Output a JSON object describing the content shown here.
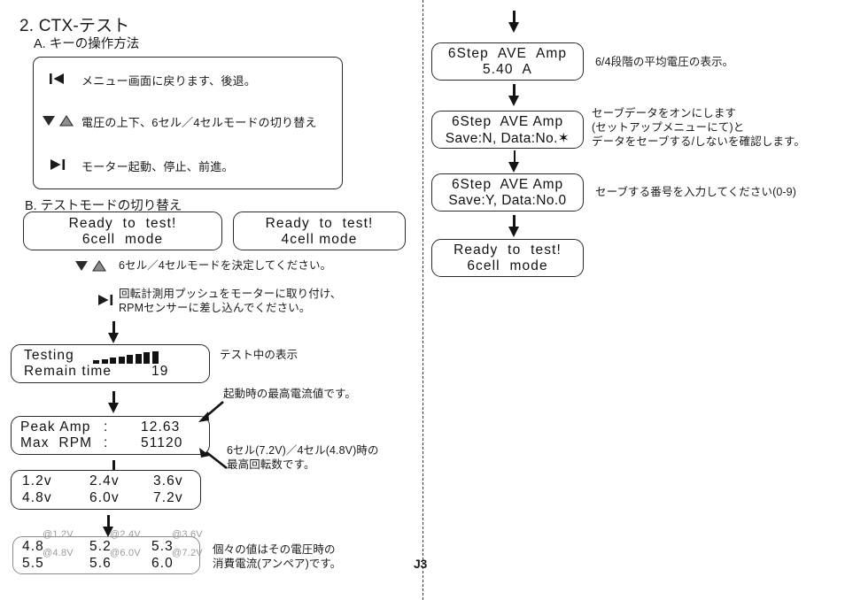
{
  "document": {
    "title": "2. CTX-テスト",
    "page_mark": "J3"
  },
  "section_a": {
    "heading": "A. キーの操作方法",
    "keys": [
      {
        "icon": "skip-back-icon",
        "glyph": "|◀",
        "description": "メニュー画面に戻ります、後退。"
      },
      {
        "icon": "up-down-arrows-icon",
        "glyph": "▼ ▲",
        "description": "電圧の上下、6セル／4セルモードの切り替え"
      },
      {
        "icon": "play-to-end-icon",
        "glyph": "▶|",
        "description": "モーター起動、停止、前進。"
      }
    ]
  },
  "section_b": {
    "heading": "B. テストモードの切り替え",
    "mode_boxes": [
      {
        "line1": "Ready  to  test!",
        "line2": "6cell  mode"
      },
      {
        "line1": "Ready  to  test!",
        "line2": "4cell mode"
      }
    ],
    "step_updown": {
      "glyph": "▼ ▲",
      "text": "6セル／4セルモードを決定してください。"
    },
    "step_play": {
      "glyph": "▶|",
      "text": "回転計測用プッシュをモーターに取り付け、\nRPMセンサーに差し込んでください。"
    },
    "testing_box": {
      "label": "Testing",
      "line2_label": "Remain time",
      "line2_value": "19",
      "progress_blocks": [
        4,
        5,
        7,
        8,
        10,
        11,
        13,
        14
      ]
    },
    "testing_note": "テスト中の表示",
    "peak_box": {
      "row1_label": "Peak Amp",
      "row1_sep": ":",
      "row1_value": "12.63",
      "row2_label": "Max  RPM",
      "row2_sep": ":",
      "row2_value": "51120"
    },
    "peak_note": "起動時の最高電流値です。",
    "rpm_note": "6セル(7.2V)／4セル(4.8V)時の\n最高回転数です。",
    "voltage_box": {
      "row1": [
        "1.2v",
        "2.4v",
        "3.6v"
      ],
      "row2": [
        "4.8v",
        "6.0v",
        "7.2v"
      ]
    },
    "amp_box": {
      "row1_values": [
        "4.8",
        "5.2",
        "5.3"
      ],
      "row1_at": [
        "@1.2V",
        "@2.4V",
        "@3.6V"
      ],
      "row2_values": [
        "5.5",
        "5.6",
        "6.0"
      ],
      "row2_at": [
        "@4.8V",
        "@6.0V",
        "@7.2V"
      ]
    },
    "amp_note": "個々の値はその電圧時の\n消費電流(アンペア)です。"
  },
  "right_column": {
    "ave_amp_box": {
      "line1": "6Step  AVE  Amp",
      "line2": "5.40  A"
    },
    "ave_amp_note": "6/4段階の平均電圧の表示。",
    "save_n_box": {
      "line1": "6Step  AVE Amp",
      "line2": "Save:N, Data:No.✶"
    },
    "save_n_note": "セーブデータをオンにします\n(セットアップメニューにて)と\nデータをセーブする/しないを確認します。",
    "save_y_box": {
      "line1": "6Step  AVE Amp",
      "line2": "Save:Y, Data:No.0"
    },
    "save_y_note": "セーブする番号を入力してください(0-9)",
    "ready_box": {
      "line1": "Ready  to  test!",
      "line2": "6cell  mode"
    }
  },
  "colors": {
    "ink": "#1a1a1a",
    "muted": "#9a9a9a",
    "divider": "#3a3a3a"
  }
}
